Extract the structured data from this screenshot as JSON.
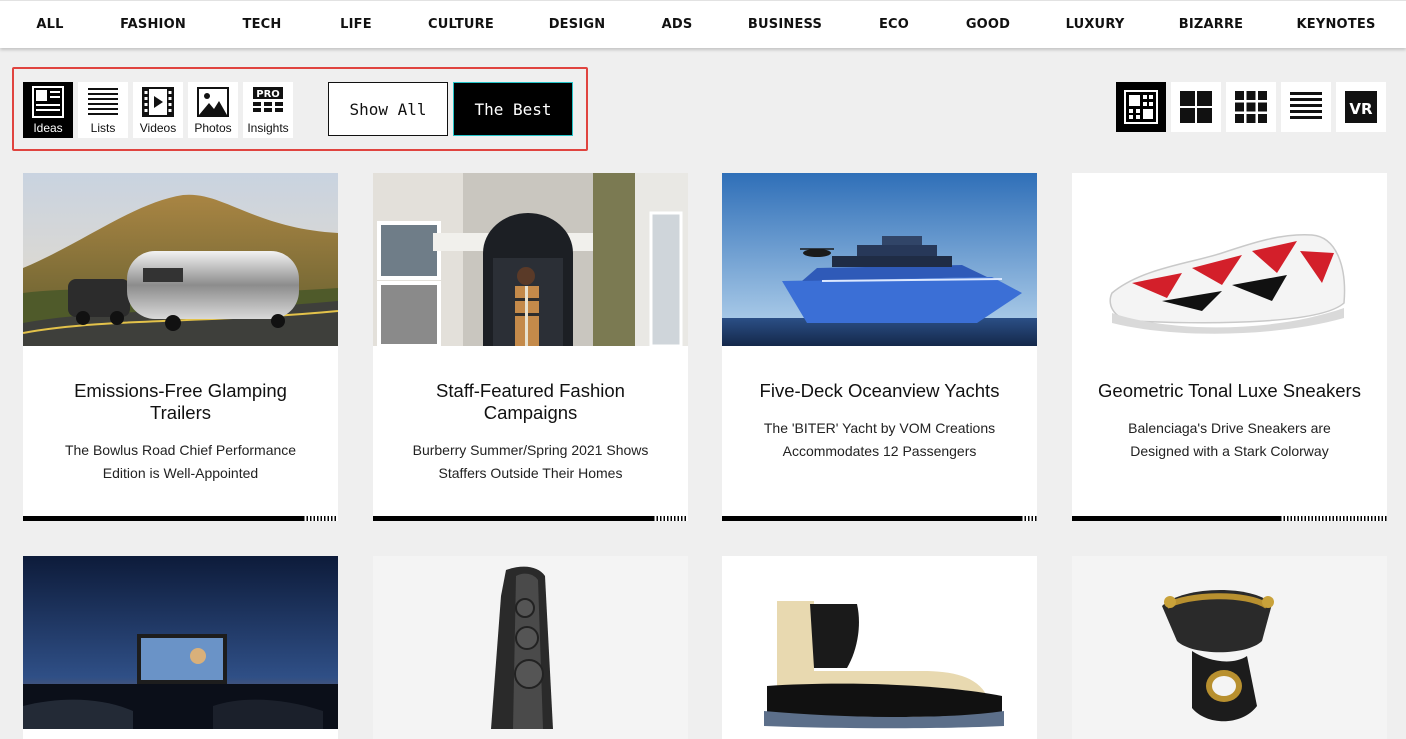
{
  "nav": [
    "ALL",
    "FASHION",
    "TECH",
    "LIFE",
    "CULTURE",
    "DESIGN",
    "ADS",
    "BUSINESS",
    "ECO",
    "GOOD",
    "LUXURY",
    "BIZARRE",
    "KEYNOTES"
  ],
  "content_types": [
    {
      "label": "Ideas",
      "icon": "ideas-icon",
      "active": true
    },
    {
      "label": "Lists",
      "icon": "lists-icon",
      "active": false
    },
    {
      "label": "Videos",
      "icon": "film-icon",
      "active": false
    },
    {
      "label": "Photos",
      "icon": "photo-icon",
      "active": false
    },
    {
      "label": "Insights",
      "icon": "pro-insights-icon",
      "badge": "PRO",
      "active": false
    }
  ],
  "modes": {
    "show_all": "Show All",
    "the_best": "The Best"
  },
  "view_modes": [
    {
      "icon": "mosaic-grid-icon",
      "active": true
    },
    {
      "icon": "four-grid-icon",
      "active": false
    },
    {
      "icon": "nine-grid-icon",
      "active": false
    },
    {
      "icon": "list-view-icon",
      "active": false
    },
    {
      "icon": "vr-icon",
      "label": "VR",
      "active": false
    }
  ],
  "cards": [
    {
      "title": "Emissions-Free Glamping Trailers",
      "description": "The Bowlus Road Chief Performance Edition is Well-Appointed",
      "progress": 0.89
    },
    {
      "title": "Staff-Featured Fashion Campaigns",
      "description": "Burberry Summer/Spring 2021 Shows Staffers Outside Their Homes",
      "progress": 0.89
    },
    {
      "title": "Five-Deck Oceanview Yachts",
      "description": "The 'BITER' Yacht by VOM Creations Accommodates 12 Passengers",
      "progress": 0.95
    },
    {
      "title": "Geometric Tonal Luxe Sneakers",
      "description": "Balenciaga's Drive Sneakers are Designed with a Stark Colorway",
      "progress": 0.66
    },
    {
      "title": "",
      "description": ""
    },
    {
      "title": "",
      "description": ""
    },
    {
      "title": "",
      "description": ""
    },
    {
      "title": "",
      "description": ""
    }
  ]
}
